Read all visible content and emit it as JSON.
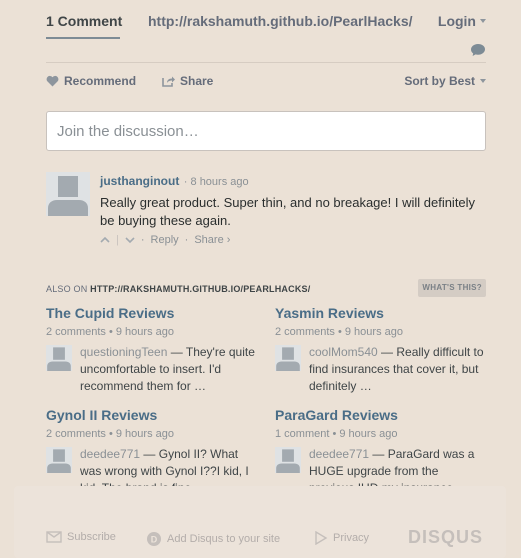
{
  "nav": {
    "comment_count": "1 Comment",
    "site_link": "http://rakshamuth.github.io/PearlHacks/",
    "login": "Login"
  },
  "actions": {
    "recommend": "Recommend",
    "share": "Share",
    "sort": "Sort by Best"
  },
  "composer": {
    "placeholder": "Join the discussion…"
  },
  "comment": {
    "author": "justhanginout",
    "time": "8 hours ago",
    "text": "Really great product. Super thin, and no breakage! I will definitely be buying these again.",
    "reply": "Reply",
    "share": "Share ›"
  },
  "also_on": {
    "label_prefix": "ALSO ON",
    "label_site": "HTTP://RAKSHAMUTH.GITHUB.IO/PEARLHACKS/",
    "whats_this": "WHAT'S THIS?"
  },
  "cards": [
    {
      "title": "The Cupid Reviews",
      "meta": "2 comments • 9 hours ago",
      "user": "questioningTeen",
      "snippet": "— They're quite uncomfortable to insert. I'd recommend them for …"
    },
    {
      "title": "Yasmin Reviews",
      "meta": "2 comments • 9 hours ago",
      "user": "coolMom540",
      "snippet": "— Really difficult to find insurances that cover it, but definitely …"
    },
    {
      "title": "Gynol II Reviews",
      "meta": "2 comments • 9 hours ago",
      "user": "deedee771",
      "snippet": "— Gynol II? What was wrong with Gynol I??I kid, I kid. The brand is fine, …"
    },
    {
      "title": "ParaGard Reviews",
      "meta": "1 comment • 9 hours ago",
      "user": "deedee771",
      "snippet": "— ParaGard was a HUGE upgrade from the previous IUD my insurance …"
    }
  ],
  "footer": {
    "subscribe": "Subscribe",
    "add_disqus": "Add Disqus to your site",
    "privacy": "Privacy",
    "brand": "DISQUS"
  },
  "colors": {
    "background": "#ebe1d6",
    "link": "#4a6d87",
    "muted": "#8a9095"
  }
}
